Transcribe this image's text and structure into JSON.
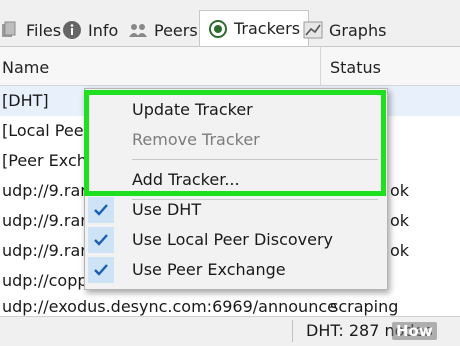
{
  "tabs": [
    {
      "label": "Files",
      "icon": "files-icon"
    },
    {
      "label": "Info",
      "icon": "info-icon"
    },
    {
      "label": "Peers",
      "icon": "peers-icon"
    },
    {
      "label": "Trackers",
      "icon": "trackers-icon"
    },
    {
      "label": "Graphs",
      "icon": "graphs-icon"
    }
  ],
  "columns": {
    "name": "Name",
    "status": "Status"
  },
  "rows": [
    {
      "name": "[DHT]",
      "status": ""
    },
    {
      "name": "[Local Peer",
      "status": ""
    },
    {
      "name": "[Peer Excha",
      "status": ""
    },
    {
      "name": "udp://9.rarb",
      "status": "ok"
    },
    {
      "name": "udp://9.rarb",
      "status": "ok"
    },
    {
      "name": "udp://9.rarb",
      "status": "ok"
    },
    {
      "name": "udp://copp",
      "status": ""
    },
    {
      "name": "udp://exodus.desync.com:6969/announce",
      "status": "scraping"
    }
  ],
  "context_menu": {
    "update_tracker": "Update Tracker",
    "remove_tracker": "Remove Tracker",
    "add_tracker": "Add Tracker...",
    "use_dht": "Use DHT",
    "use_local_peer_discovery": "Use Local Peer Discovery",
    "use_peer_exchange": "Use Peer Exchange"
  },
  "statusbar": {
    "dht": "DHT: 287 nodes"
  },
  "watermark": "How",
  "colors": {
    "highlight": "#1ee01e",
    "check": "#1a5fb4",
    "selected_row": "#e8f0fb"
  }
}
